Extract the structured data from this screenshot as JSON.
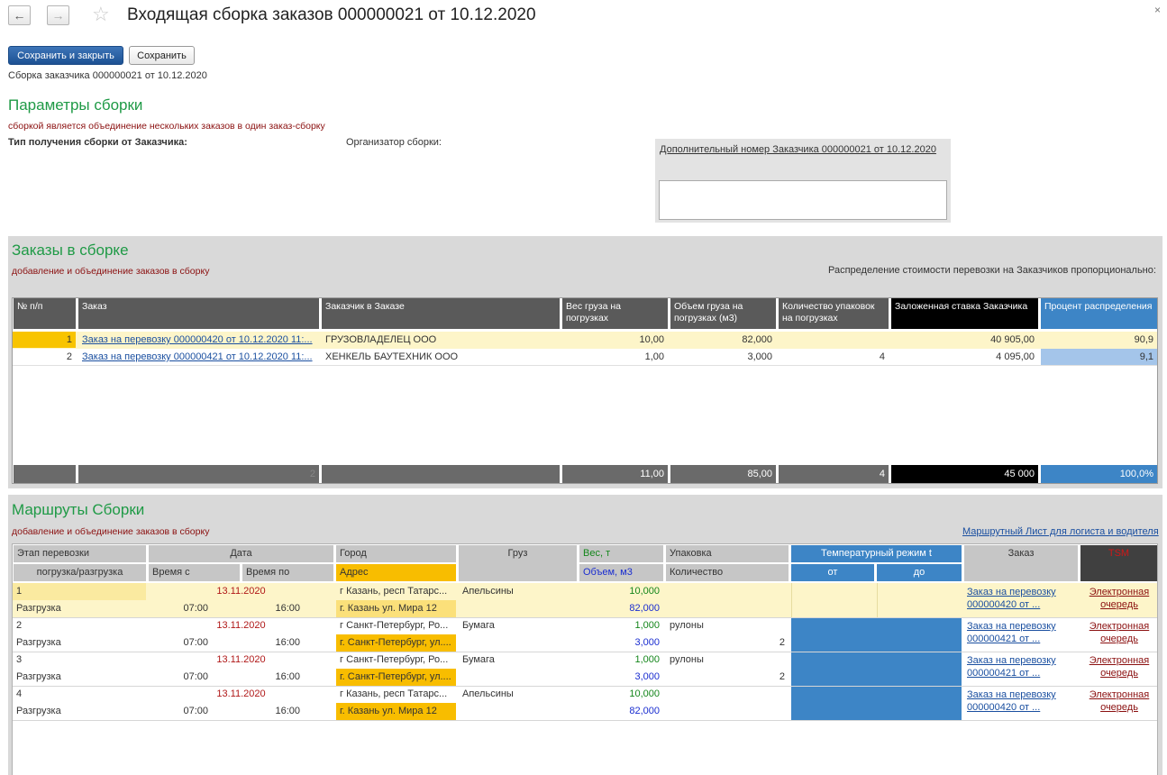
{
  "header": {
    "title": "Входящая сборка заказов 000000021 от 10.12.2020",
    "close": "×"
  },
  "toolbar": {
    "save_close": "Сохранить и закрыть",
    "save": "Сохранить"
  },
  "doc_caption": "Сборка заказчика 000000021 от 10.12.2020",
  "params": {
    "title": "Параметры сборки",
    "subtitle": "сборкой является объединение нескольких заказов в один заказ-сборку",
    "type_label": "Тип получения сборки от Заказчика:",
    "organizer_label": "Организатор сборки:",
    "extra_number_link": "Дополнительный номер Заказчика 000000021 от 10.12.2020",
    "extra_number_value": ""
  },
  "orders": {
    "title": "Заказы в сборке",
    "subtitle": "добавление и объединение заказов в сборку",
    "distribution": "Распределение стоимости перевозки на Заказчиков пропорционально:",
    "columns": {
      "num": "№ п/п",
      "order": "Заказ",
      "customer": "Заказчик в Заказе",
      "weight": "Вес груза на погрузках",
      "volume": "Объем груза на погрузках (м3)",
      "qty": "Количество упаковок на погрузках",
      "rate": "Заложенная ставка Заказчика",
      "percent": "Процент распределения"
    },
    "rows": [
      {
        "num": "1",
        "order": "Заказ на перевозку 000000420 от 10.12.2020 11:...",
        "customer": "ГРУЗОВЛАДЕЛЕЦ ООО",
        "weight": "10,00",
        "volume": "82,000",
        "qty": "",
        "rate": "40 905,00",
        "percent": "90,9"
      },
      {
        "num": "2",
        "order": "Заказ на перевозку 000000421 от 10.12.2020 11:...",
        "customer": "ХЕНКЕЛЬ БАУТЕХНИК ООО",
        "weight": "1,00",
        "volume": "3,000",
        "qty": "4",
        "rate": "4 095,00",
        "percent": "9,1"
      }
    ],
    "totals": {
      "count": "2",
      "weight": "11,00",
      "volume": "85,00",
      "qty": "4",
      "rate": "45 000",
      "percent": "100,0%"
    }
  },
  "routes": {
    "title": "Маршруты Сборки",
    "subtitle": "добавление и объединение заказов в сборку",
    "route_sheet_link": "Маршрутный Лист для логиста и водителя",
    "columns": {
      "stage": "Этап перевозки",
      "stage_sub": "погрузка/разгрузка",
      "date": "Дата",
      "time_from": "Время с",
      "time_to": "Время по",
      "city": "Город",
      "address": "Адрес",
      "cargo": "Груз",
      "weight": "Вес, т",
      "volume": "Объем, м3",
      "package": "Упаковка",
      "qty": "Количество",
      "temp": "Температурный режим t",
      "temp_from": "от",
      "temp_to": "до",
      "order": "Заказ",
      "tsm": "TSM"
    },
    "rows": [
      {
        "num": "1",
        "stage": "Разгрузка",
        "date": "13.11.2020",
        "time_from": "07:00",
        "time_to": "16:00",
        "city": "г Казань,  респ Татарс...",
        "address": "г. Казань ул. Мира 12",
        "cargo": "Апельсины",
        "weight": "10,000",
        "volume": "82,000",
        "package": "",
        "qty": "",
        "order_line1": "Заказ на перевозку",
        "order_line2": "000000420 от ...",
        "queue_line1": "Электронная",
        "queue_line2": "очередь"
      },
      {
        "num": "2",
        "stage": "Разгрузка",
        "date": "13.11.2020",
        "time_from": "07:00",
        "time_to": "16:00",
        "city": "г Санкт-Петербург, Ро...",
        "address": "г. Санкт-Петербург, ул....",
        "cargo": "Бумага",
        "weight": "1,000",
        "volume": "3,000",
        "package": "рулоны",
        "qty": "2",
        "order_line1": "Заказ на перевозку",
        "order_line2": "000000421 от ...",
        "queue_line1": "Электронная",
        "queue_line2": "очередь"
      },
      {
        "num": "3",
        "stage": "Разгрузка",
        "date": "13.11.2020",
        "time_from": "07:00",
        "time_to": "16:00",
        "city": "г Санкт-Петербург, Ро...",
        "address": "г. Санкт-Петербург, ул....",
        "cargo": "Бумага",
        "weight": "1,000",
        "volume": "3,000",
        "package": "рулоны",
        "qty": "2",
        "order_line1": "Заказ на перевозку",
        "order_line2": "000000421 от ...",
        "queue_line1": "Электронная",
        "queue_line2": "очередь"
      },
      {
        "num": "4",
        "stage": "Разгрузка",
        "date": "13.11.2020",
        "time_from": "07:00",
        "time_to": "16:00",
        "city": "г Казань,  респ Татарс...",
        "address": "г. Казань ул. Мира 12",
        "cargo": "Апельсины",
        "weight": "10,000",
        "volume": "82,000",
        "package": "",
        "qty": "",
        "order_line1": "Заказ на перевозку",
        "order_line2": "000000420 от ...",
        "queue_line1": "Электронная",
        "queue_line2": "очередь"
      }
    ]
  },
  "colors": {
    "accent_green": "#1f9a46",
    "header_dark": "#5a5a5a",
    "header_black": "#000000",
    "header_blue": "#3d85c6",
    "selected_row": "#fdf5c9",
    "address_orange": "#f8bd00",
    "temp_blue": "#3d85c6"
  },
  "icons": [
    "back-arrow-icon",
    "forward-arrow-icon",
    "star-icon",
    "close-icon"
  ]
}
